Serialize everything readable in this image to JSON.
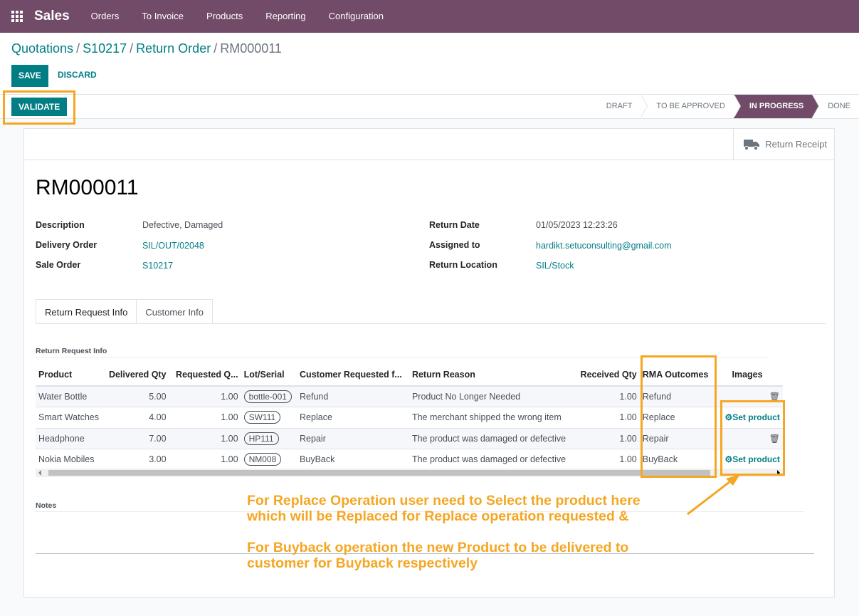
{
  "navbar": {
    "brand": "Sales",
    "menu": [
      "Orders",
      "To Invoice",
      "Products",
      "Reporting",
      "Configuration"
    ]
  },
  "breadcrumb": {
    "items": [
      "Quotations",
      "S10217",
      "Return Order"
    ],
    "current": "RM000011"
  },
  "actions": {
    "save": "SAVE",
    "discard": "DISCARD",
    "validate": "VALIDATE"
  },
  "stages": [
    "DRAFT",
    "TO BE APPROVED",
    "IN PROGRESS",
    "DONE"
  ],
  "active_stage": "IN PROGRESS",
  "button_box": {
    "return_receipt": "Return Receipt"
  },
  "record": {
    "name": "RM000011",
    "left_fields": [
      {
        "label": "Description",
        "value": "Defective, Damaged"
      },
      {
        "label": "Delivery Order",
        "value": "SIL/OUT/02048"
      },
      {
        "label": "Sale Order",
        "value": "S10217"
      }
    ],
    "right_fields": [
      {
        "label": "Return Date",
        "value": "01/05/2023 12:23:26"
      },
      {
        "label": "Assigned to",
        "value": "hardikt.setuconsulting@gmail.com"
      },
      {
        "label": "Return Location",
        "value": "SIL/Stock"
      }
    ]
  },
  "tabs": [
    "Return Request Info",
    "Customer Info"
  ],
  "section_label": "Return Request Info",
  "table": {
    "headers": [
      "Product",
      "Delivered Qty",
      "Requested Q...",
      "Lot/Serial",
      "Customer Requested f...",
      "Return Reason",
      "Received Qty",
      "RMA Outcomes",
      "Images"
    ],
    "rows": [
      {
        "product": "Water Bottle",
        "delivered": "5.00",
        "requested": "1.00",
        "lot": "bottle-001",
        "customer_req": "Refund",
        "reason": "Product No Longer Needed",
        "received": "1.00",
        "outcome": "Refund",
        "image": ""
      },
      {
        "product": "Smart Watches",
        "delivered": "4.00",
        "requested": "1.00",
        "lot": "SW111",
        "customer_req": "Replace",
        "reason": "The merchant shipped the wrong item",
        "received": "1.00",
        "outcome": "Replace",
        "image": "Set product"
      },
      {
        "product": "Headphone",
        "delivered": "7.00",
        "requested": "1.00",
        "lot": "HP111",
        "customer_req": "Repair",
        "reason": "The product was damaged or defective",
        "received": "1.00",
        "outcome": "Repair",
        "image": ""
      },
      {
        "product": "Nokia Mobiles",
        "delivered": "3.00",
        "requested": "1.00",
        "lot": "NM008",
        "customer_req": "BuyBack",
        "reason": "The product was damaged or defective",
        "received": "1.00",
        "outcome": "BuyBack",
        "image": "Set product"
      }
    ]
  },
  "notes_label": "Notes",
  "annotation": {
    "line1": "For Replace Operation user need to Select the product here",
    "line2": "which will be Replaced for Replace operation requested &",
    "line3": "For Buyback operation the new Product to be delivered to",
    "line4": "customer for Buyback respectively"
  },
  "colors": {
    "brand": "#714b67",
    "primary": "#017e84",
    "highlight": "#f5a623"
  }
}
